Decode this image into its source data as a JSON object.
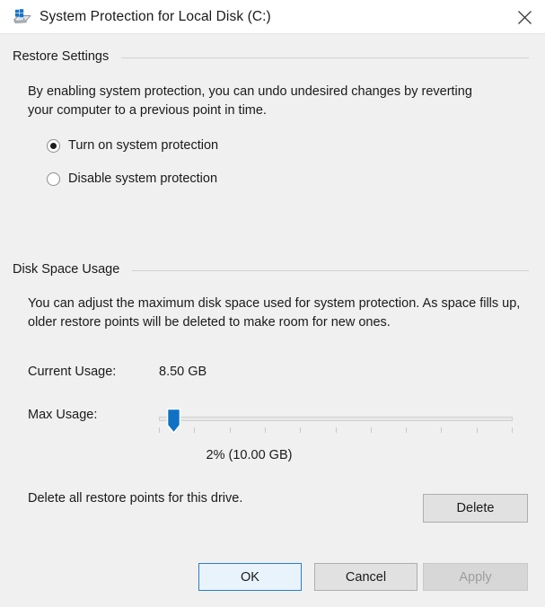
{
  "window": {
    "title": "System Protection for Local Disk (C:)",
    "icon": "hard-drive-icon",
    "close_label": "✕"
  },
  "restore_settings": {
    "group_label": "Restore Settings",
    "description": "By enabling system protection, you can undo undesired changes by reverting your computer to a previous point in time.",
    "options": [
      {
        "label": "Turn on system protection",
        "selected": true
      },
      {
        "label": "Disable system protection",
        "selected": false
      }
    ]
  },
  "disk_space_usage": {
    "group_label": "Disk Space Usage",
    "description": "You can adjust the maximum disk space used for system protection. As space fills up, older restore points will be deleted to make room for new ones.",
    "current_usage_label": "Current Usage:",
    "current_usage_value": "8.50 GB",
    "max_usage_label": "Max Usage:",
    "slider": {
      "percent": 2,
      "value_text": "2% (10.00 GB)",
      "min": 0,
      "max": 100,
      "tick_count": 11,
      "thumb_color": "#0f72c4"
    },
    "delete_text": "Delete all restore points for this drive.",
    "delete_button": "Delete"
  },
  "footer": {
    "ok": "OK",
    "cancel": "Cancel",
    "apply": "Apply",
    "apply_enabled": false
  },
  "colors": {
    "accent": "#0f72c4",
    "window_bg": "#f0f0f0",
    "titlebar_bg": "#ffffff",
    "default_button_border": "#2a7fc9"
  }
}
